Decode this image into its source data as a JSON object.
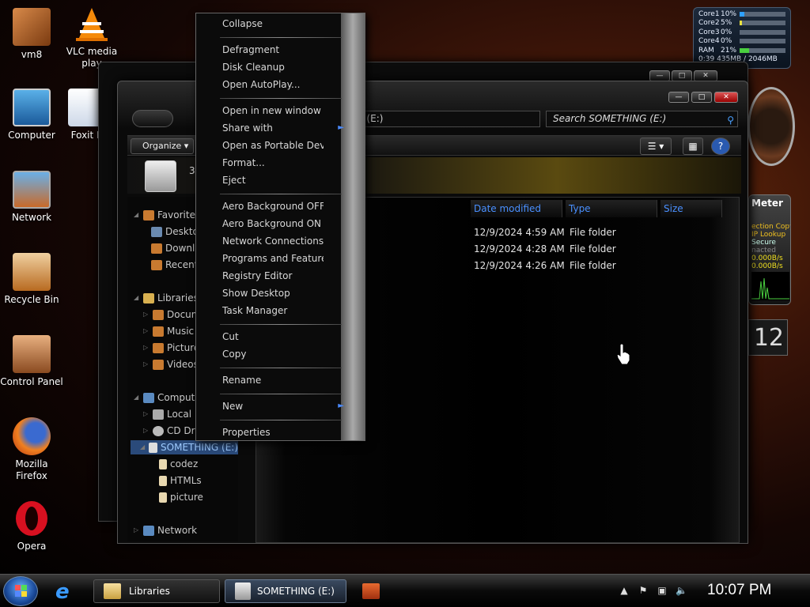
{
  "desktop": {
    "icons": [
      {
        "label": "vm8"
      },
      {
        "label": "VLC media play"
      },
      {
        "label": "Computer"
      },
      {
        "label": "Foxit R"
      },
      {
        "label": "Network"
      },
      {
        "label": "Recycle Bin"
      },
      {
        "label": "Control Panel"
      },
      {
        "label": "Mozilla Firefox"
      },
      {
        "label": "Opera"
      }
    ]
  },
  "gadgets": {
    "cpu": {
      "rows": [
        {
          "name": "Core1",
          "pct": "10%",
          "level": 0.1
        },
        {
          "name": "Core2",
          "pct": "5%",
          "level": 0.05
        },
        {
          "name": "Core3",
          "pct": "0%",
          "level": 0
        },
        {
          "name": "Core4",
          "pct": "0%",
          "level": 0
        },
        {
          "name": "RAM",
          "pct": "21%",
          "level": 0.21
        }
      ],
      "mem": "0:39  435MB / 2046MB"
    },
    "meter": {
      "title": "Meter",
      "lines": [
        "ection Copy",
        "IP Lookup",
        "Secure",
        "nacted",
        "0.000B/s",
        "0.000B/s"
      ]
    },
    "date": "12"
  },
  "explorer": {
    "address": "S (E:)",
    "search_placeholder": "Search SOMETHING (E:)",
    "organize": "Organize",
    "drive_header_text": "3",
    "columns": [
      "Date modified",
      "Type",
      "Size"
    ],
    "rows": [
      {
        "date": "12/9/2024 4:59 AM",
        "type": "File folder"
      },
      {
        "date": "12/9/2024 4:28 AM",
        "type": "File folder"
      },
      {
        "date": "12/9/2024 4:26 AM",
        "type": "File folder"
      }
    ],
    "nav": {
      "favorites": "Favorites",
      "desktop": "Desktop",
      "downloads": "Downloads",
      "recent": "Recent",
      "libraries": "Libraries",
      "documents": "Documents",
      "music": "Music",
      "pictures": "Pictures",
      "videos": "Videos",
      "computer": "Computer",
      "local": "Local Disk",
      "cd": "CD Drive",
      "something": "SOMETHING (E:)",
      "codez": "codez",
      "htmls": "HTMLs",
      "picture": "picture",
      "network": "Network"
    }
  },
  "context_menu": {
    "items": [
      "Collapse",
      "Defragment",
      "Disk Cleanup",
      "Open AutoPlay...",
      "Open in new window",
      "Share with",
      "Open as Portable Device",
      "Format...",
      "Eject",
      "Aero Background OFF",
      "Aero Background ON",
      "Network Connections",
      "Programs and Features",
      "Registry Editor",
      "Show Desktop",
      "Task Manager",
      "Cut",
      "Copy",
      "Rename",
      "New",
      "Properties"
    ]
  },
  "taskbar": {
    "tasks": [
      {
        "label": "Libraries"
      },
      {
        "label": "SOMETHING (E:)"
      }
    ],
    "clock": "10:07 PM"
  },
  "colors": {
    "accent_blue": "#4a90ff",
    "selection": "#2a4a7a",
    "cpu_bar": "#2fa0ff"
  }
}
